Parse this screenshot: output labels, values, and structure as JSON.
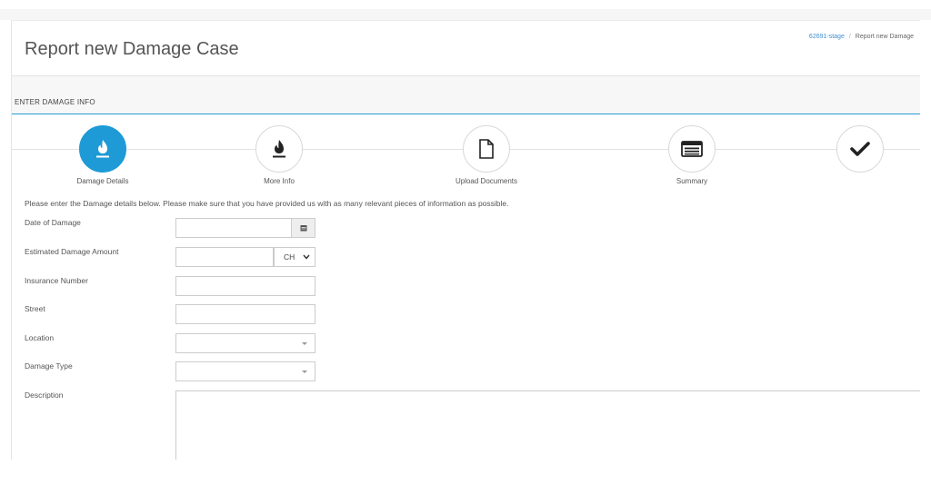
{
  "page": {
    "title": "Report new Damage Case"
  },
  "breadcrumb": {
    "items": [
      "62691-stage",
      "Report new Damage"
    ]
  },
  "section": {
    "title": "ENTER DAMAGE INFO"
  },
  "wizard": {
    "steps": [
      {
        "label": "Damage Details",
        "icon": "fire-icon",
        "active": true
      },
      {
        "label": "More Info",
        "icon": "fire-icon",
        "active": false
      },
      {
        "label": "Upload Documents",
        "icon": "document-icon",
        "active": false
      },
      {
        "label": "Summary",
        "icon": "list-icon",
        "active": false
      },
      {
        "label": "",
        "icon": "checkmark-icon",
        "active": false
      }
    ]
  },
  "form": {
    "intro": "Please enter the Damage details below. Please make sure that you have provided us with as many relevant pieces of information as possible.",
    "date_label": "Date of Damage",
    "amount_label": "Estimated Damage Amount",
    "currency_value": "CH",
    "insurance_label": "Insurance Number",
    "street_label": "Street",
    "location_label": "Location",
    "damage_type_label": "Damage Type",
    "description_label": "Description"
  },
  "colors": {
    "accent": "#1e9ad6",
    "link": "#3f8fd2"
  }
}
